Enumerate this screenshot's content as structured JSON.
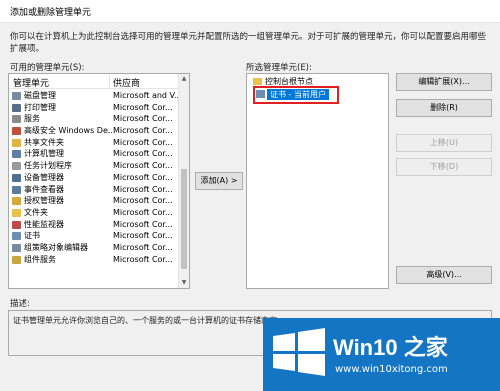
{
  "window": {
    "title": "添加或删除管理单元"
  },
  "intro": "你可以在计算机上为此控制台选择可用的管理单元并配置所选的一组管理单元。对于可扩展的管理单元，你可以配置要启用哪些扩展项。",
  "left": {
    "label": "可用的管理单元(S):",
    "headers": {
      "name": "管理单元",
      "vendor": "供应商"
    },
    "items": [
      {
        "name": "磁盘管理",
        "vendor": "Microsoft and V...",
        "icon": "disk-icon",
        "color": "#7a8aa0"
      },
      {
        "name": "打印管理",
        "vendor": "Microsoft Cor...",
        "icon": "printer-icon",
        "color": "#5a6d86"
      },
      {
        "name": "服务",
        "vendor": "Microsoft Cor...",
        "icon": "gear-icon",
        "color": "#8b8b8b"
      },
      {
        "name": "高级安全 Windows De...",
        "vendor": "Microsoft Cor...",
        "icon": "firewall-icon",
        "color": "#c0503a"
      },
      {
        "name": "共享文件夹",
        "vendor": "Microsoft Cor...",
        "icon": "shared-folder-icon",
        "color": "#e0b640"
      },
      {
        "name": "计算机管理",
        "vendor": "Microsoft Cor...",
        "icon": "computer-icon",
        "color": "#5f7fa3"
      },
      {
        "name": "任务计划程序",
        "vendor": "Microsoft Cor...",
        "icon": "clock-icon",
        "color": "#9a9a9a"
      },
      {
        "name": "设备管理器",
        "vendor": "Microsoft Cor...",
        "icon": "device-icon",
        "color": "#4f6f90"
      },
      {
        "name": "事件查看器",
        "vendor": "Microsoft Cor...",
        "icon": "event-icon",
        "color": "#5a7b9c"
      },
      {
        "name": "授权管理器",
        "vendor": "Microsoft Cor...",
        "icon": "authorization-icon",
        "color": "#d6a83a"
      },
      {
        "name": "文件夹",
        "vendor": "Microsoft Cor...",
        "icon": "folder-icon",
        "color": "#e8c24a"
      },
      {
        "name": "性能监视器",
        "vendor": "Microsoft Cor...",
        "icon": "performance-icon",
        "color": "#c04a4a"
      },
      {
        "name": "证书",
        "vendor": "Microsoft Cor...",
        "icon": "certificate-icon",
        "color": "#6d8fb4"
      },
      {
        "name": "组策略对象编辑器",
        "vendor": "Microsoft Cor...",
        "icon": "group-policy-icon",
        "color": "#7a8aa0"
      },
      {
        "name": "组件服务",
        "vendor": "Microsoft Cor...",
        "icon": "component-icon",
        "color": "#c9a640"
      }
    ]
  },
  "add_button": "添加(A) >",
  "right": {
    "label": "所选管理单元(E):",
    "root": "控制台根节点",
    "selected": "证书 - 当前用户"
  },
  "buttons": {
    "edit": "编辑扩展(X)...",
    "remove": "删除(R)",
    "up": "上移(U)",
    "down": "下移(D)",
    "advanced": "高级(V)..."
  },
  "description": {
    "label": "描述:",
    "text": "证书管理单元允许你浏览自己的、一个服务的或一台计算机的证书存储内容。"
  },
  "watermark": {
    "brand": "Win10 之家",
    "url": "www.win10xitong.com"
  }
}
